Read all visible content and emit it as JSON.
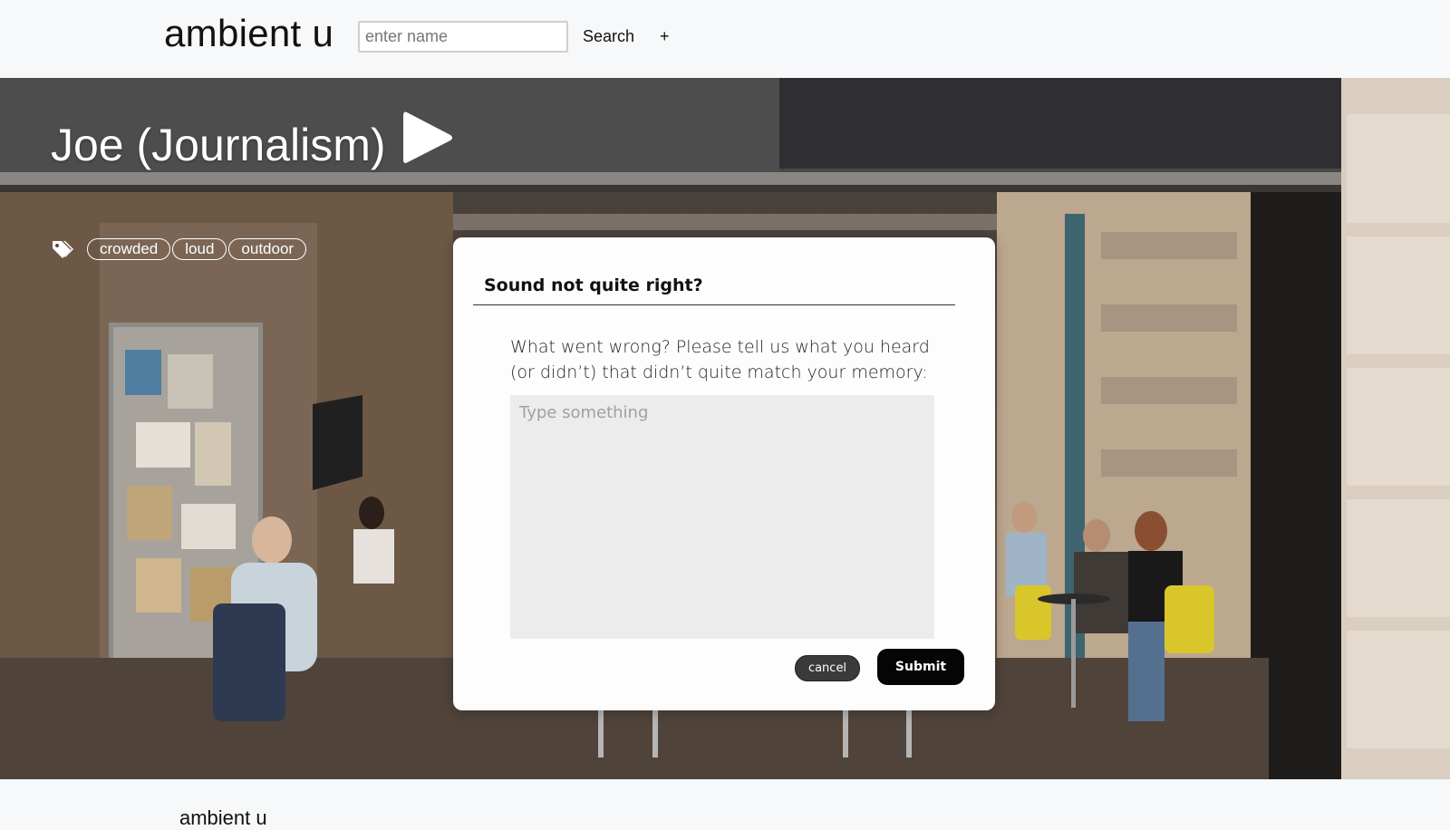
{
  "header": {
    "brand": "ambient u",
    "search_placeholder": "enter name",
    "search_label": "Search",
    "add_label": "+"
  },
  "hero": {
    "title": "Joe (Journalism)",
    "tags": [
      "crowded",
      "loud",
      "outdoor"
    ],
    "icons": {
      "play": "play-icon",
      "tags": "tag-icon"
    }
  },
  "modal": {
    "title": "Sound not quite right?",
    "question": "What went wrong? Please tell us what you heard (or didn’t) that didn’t quite match your memory:",
    "textarea_placeholder": "Type something",
    "textarea_value": "",
    "cancel_label": "cancel",
    "submit_label": "Submit"
  },
  "footer": {
    "brand": "ambient u"
  },
  "colors": {
    "page_background": "#f7f8f9",
    "modal_background": "#fdfdfd",
    "textarea_background": "#ececec",
    "submit_button": "#050505",
    "cancel_button": "#3a3a3a"
  }
}
